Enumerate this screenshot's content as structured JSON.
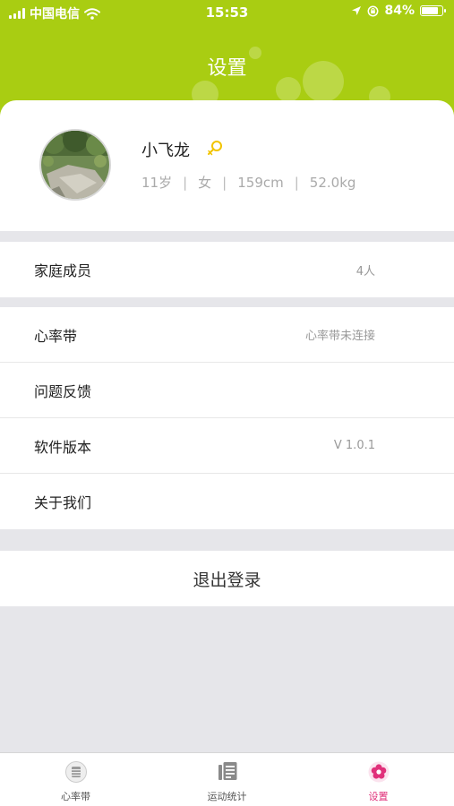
{
  "status_bar": {
    "carrier": "中国电信",
    "time": "15:53",
    "battery": "84%",
    "battery_level": 0.84,
    "signal_icon": "signal-bars-icon",
    "wifi_icon": "wifi-icon",
    "location_icon": "location-arrow-icon",
    "lock_icon": "orientation-lock-icon",
    "battery_icon": "battery-icon"
  },
  "header": {
    "title": "设置",
    "color": "#a9cd12"
  },
  "profile": {
    "name": "小飞龙",
    "age": "11岁",
    "gender": "女",
    "height": "159cm",
    "weight": "52.0kg",
    "edit_icon": "edit-pin-icon"
  },
  "menu": {
    "family": {
      "label": "家庭成员",
      "value": "4人"
    },
    "heart_strap": {
      "label": "心率带",
      "value": "心率带未连接"
    },
    "feedback": {
      "label": "问题反馈"
    },
    "version": {
      "label": "软件版本",
      "value": "V 1.0.1"
    },
    "about": {
      "label": "关于我们"
    }
  },
  "logout": {
    "label": "退出登录"
  },
  "tabbar": {
    "items": [
      {
        "label": "心率带",
        "icon": "heart-strap-icon",
        "active": false
      },
      {
        "label": "运动统计",
        "icon": "stats-list-icon",
        "active": false
      },
      {
        "label": "设置",
        "icon": "flower-settings-icon",
        "active": true
      }
    ],
    "active_color": "#e0307a"
  }
}
